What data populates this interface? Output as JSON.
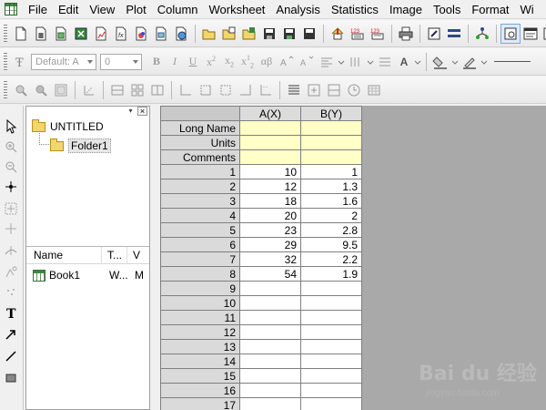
{
  "menubar": {
    "items": [
      "File",
      "Edit",
      "View",
      "Plot",
      "Column",
      "Worksheet",
      "Analysis",
      "Statistics",
      "Image",
      "Tools",
      "Format",
      "Wi"
    ]
  },
  "format_toolbar": {
    "font_value": "Default: A",
    "size_value": "0",
    "bold": "B",
    "italic": "I",
    "underline": "U",
    "greek": "αβ",
    "superscript_base": "x",
    "superscript_exp": "2",
    "subscript_base": "x",
    "subscript_index": "2",
    "supersub_base": "x",
    "supersub_exp": "1",
    "supersub_index": "2",
    "font_color": "A"
  },
  "explorer": {
    "root_label": "UNTITLED",
    "folder_label": "Folder1",
    "pin_glyph": "▾",
    "close_glyph": "×",
    "columns": [
      "Name",
      "T...",
      "V"
    ],
    "items": [
      {
        "name": "Book1",
        "type": "W...",
        "view": "M"
      }
    ]
  },
  "worksheet": {
    "columns": [
      "A(X)",
      "B(Y)"
    ],
    "label_rows": [
      "Long Name",
      "Units",
      "Comments"
    ],
    "rows": [
      {
        "n": "1",
        "a": "10",
        "b": "1"
      },
      {
        "n": "2",
        "a": "12",
        "b": "1.3"
      },
      {
        "n": "3",
        "a": "18",
        "b": "1.6"
      },
      {
        "n": "4",
        "a": "20",
        "b": "2"
      },
      {
        "n": "5",
        "a": "23",
        "b": "2.8"
      },
      {
        "n": "6",
        "a": "29",
        "b": "9.5"
      },
      {
        "n": "7",
        "a": "32",
        "b": "2.2"
      },
      {
        "n": "8",
        "a": "54",
        "b": "1.9"
      },
      {
        "n": "9",
        "a": "",
        "b": ""
      },
      {
        "n": "10",
        "a": "",
        "b": ""
      },
      {
        "n": "11",
        "a": "",
        "b": ""
      },
      {
        "n": "12",
        "a": "",
        "b": ""
      },
      {
        "n": "13",
        "a": "",
        "b": ""
      },
      {
        "n": "14",
        "a": "",
        "b": ""
      },
      {
        "n": "15",
        "a": "",
        "b": ""
      },
      {
        "n": "16",
        "a": "",
        "b": ""
      },
      {
        "n": "17",
        "a": "",
        "b": ""
      }
    ]
  },
  "watermark": {
    "logo": "Bai du 经验",
    "url": "jingyan.baidu.com"
  },
  "colors": {
    "label_row_bg": "#ffffc8",
    "header_bg": "#dcdcdc",
    "sheet_bg": "#a9a9a9"
  }
}
